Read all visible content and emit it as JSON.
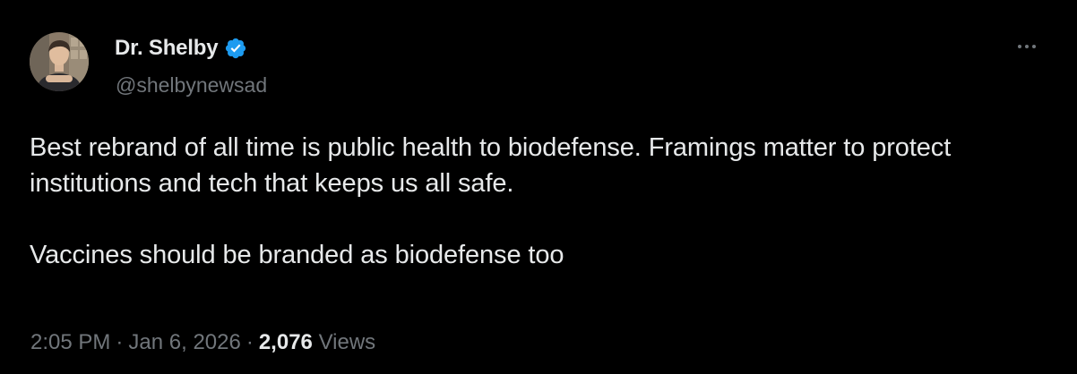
{
  "author": {
    "display_name": "Dr. Shelby",
    "handle": "@shelbynewsad",
    "verified": true,
    "avatar_icon": "profile-photo"
  },
  "tweet": {
    "paragraphs": [
      "Best rebrand of all time is public health to biodefense. Framings matter to protect institutions and tech that keeps us all safe.",
      "Vaccines should be branded as biodefense too"
    ]
  },
  "meta": {
    "time": "2:05 PM",
    "separator": "·",
    "date": "Jan 6, 2026",
    "views_count": "2,076",
    "views_label": "Views"
  },
  "icons": {
    "verified": "verified-badge-icon",
    "more": "more-options-icon"
  },
  "colors": {
    "background": "#000000",
    "primary_text": "#e7e9ea",
    "secondary_text": "#71767b",
    "verified_blue": "#1d9bf0"
  }
}
